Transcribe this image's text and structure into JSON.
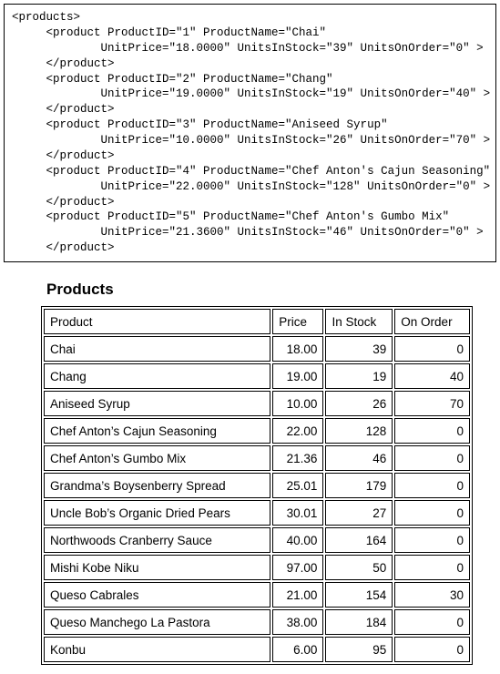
{
  "xml_snippet": {
    "root_open": "<products>",
    "products": [
      {
        "id": "1",
        "name": "Chai",
        "unit_price": "18.0000",
        "in_stock": "39",
        "on_order": "0"
      },
      {
        "id": "2",
        "name": "Chang",
        "unit_price": "19.0000",
        "in_stock": "19",
        "on_order": "40"
      },
      {
        "id": "3",
        "name": "Aniseed Syrup",
        "unit_price": "10.0000",
        "in_stock": "26",
        "on_order": "70"
      },
      {
        "id": "4",
        "name": "Chef Anton's Cajun Seasoning",
        "unit_price": "22.0000",
        "in_stock": "128",
        "on_order": "0"
      },
      {
        "id": "5",
        "name": "Chef Anton's Gumbo Mix",
        "unit_price": "21.3600",
        "in_stock": "46",
        "on_order": "0"
      }
    ],
    "close_tag": "</product>"
  },
  "table": {
    "title": "Products",
    "headers": {
      "product": "Product",
      "price": "Price",
      "in_stock": "In Stock",
      "on_order": "On Order"
    },
    "rows": [
      {
        "product": "Chai",
        "price": "18.00",
        "in_stock": "39",
        "on_order": "0"
      },
      {
        "product": "Chang",
        "price": "19.00",
        "in_stock": "19",
        "on_order": "40"
      },
      {
        "product": "Aniseed Syrup",
        "price": "10.00",
        "in_stock": "26",
        "on_order": "70"
      },
      {
        "product": "Chef Anton’s Cajun Seasoning",
        "price": "22.00",
        "in_stock": "128",
        "on_order": "0"
      },
      {
        "product": "Chef Anton’s Gumbo Mix",
        "price": "21.36",
        "in_stock": "46",
        "on_order": "0"
      },
      {
        "product": "Grandma’s Boysenberry Spread",
        "price": "25.01",
        "in_stock": "179",
        "on_order": "0"
      },
      {
        "product": "Uncle Bob’s Organic Dried Pears",
        "price": "30.01",
        "in_stock": "27",
        "on_order": "0"
      },
      {
        "product": "Northwoods Cranberry Sauce",
        "price": "40.00",
        "in_stock": "164",
        "on_order": "0"
      },
      {
        "product": "Mishi Kobe Niku",
        "price": "97.00",
        "in_stock": "50",
        "on_order": "0"
      },
      {
        "product": "Queso Cabrales",
        "price": "21.00",
        "in_stock": "154",
        "on_order": "30"
      },
      {
        "product": "Queso Manchego La Pastora",
        "price": "38.00",
        "in_stock": "184",
        "on_order": "0"
      },
      {
        "product": "Konbu",
        "price": "6.00",
        "in_stock": "95",
        "on_order": "0"
      }
    ]
  }
}
